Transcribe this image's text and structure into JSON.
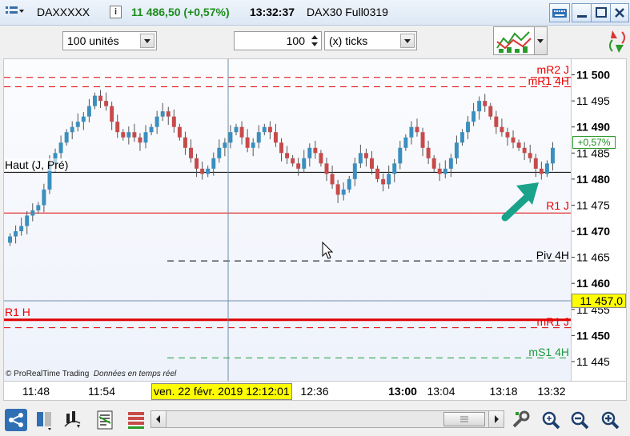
{
  "titlebar": {
    "symbol": "DAXXXXX",
    "info_icon": "info-icon",
    "price": "11 486,50",
    "change": "(+0,57%)",
    "time": "13:32:37",
    "instrument": "DAX30 Full0319"
  },
  "toolbar": {
    "quantity": "100 unités",
    "ticks_value": "100",
    "ticks_unit": "(x) ticks"
  },
  "chart": {
    "copyright": "© ProRealTime Trading",
    "realtime": "Données en temps réel",
    "crosshair_date": "ven. 22 févr. 2019 12:12:01",
    "current_price": "11 457,0",
    "change_badge": "+0,57%",
    "colors": {
      "up": "#3a8fbf",
      "down": "#c84a4a",
      "resistance": "#e00000",
      "support_green": "#1a9a3a",
      "arrow": "#1aa38a",
      "price_tag": "#ffff00"
    }
  },
  "levels": {
    "mR2_J": "mR2 J",
    "mR1_4H": "mR1 4H",
    "haut_j_pre": "Haut (J, Pré)",
    "R1_J": "R1 J",
    "Piv_4H": "Piv 4H",
    "R1_H": "R1 H",
    "mR1_J": "mR1 J",
    "mS1_4H": "mS1 4H"
  },
  "chart_data": {
    "type": "candlestick",
    "ylim": [
      11441,
      11503
    ],
    "y_ticks": [
      "11 500",
      "11 495",
      "11 490",
      "11 485",
      "11 480",
      "11 475",
      "11 470",
      "11 465",
      "11 460",
      "11 455",
      "11 450",
      "11 445"
    ],
    "x_ticks": [
      "11:48",
      "11:54",
      "12:36",
      "13:00",
      "13:04",
      "13:18",
      "13:32"
    ],
    "series_close": [
      11469,
      11470,
      11471,
      11473,
      11474,
      11475,
      11478,
      11483,
      11485,
      11487,
      11489,
      11490,
      11491,
      11492,
      11494,
      11496,
      11495,
      11494,
      11491,
      11489,
      11488,
      11489,
      11488,
      11487,
      11489,
      11490,
      11492,
      11493,
      11492,
      11490,
      11488,
      11486,
      11484,
      11482,
      11481,
      11482,
      11484,
      11486,
      11487,
      11489,
      11490,
      11488,
      11486,
      11487,
      11489,
      11490,
      11489,
      11487,
      11485,
      11484,
      11483,
      11482,
      11484,
      11486,
      11485,
      11483,
      11481,
      11479,
      11477,
      11478,
      11480,
      11483,
      11485,
      11484,
      11482,
      11480,
      11479,
      11481,
      11483,
      11486,
      11488,
      11490,
      11489,
      11486,
      11484,
      11482,
      11481,
      11482,
      11484,
      11487,
      11489,
      11491,
      11493,
      11495,
      11494,
      11492,
      11490,
      11489,
      11488,
      11487,
      11486,
      11485,
      11484,
      11482,
      11481,
      11483,
      11486
    ]
  },
  "bottombar": {
    "icons": [
      "share-icon",
      "layout-icon",
      "indicator-icon",
      "list-icon",
      "table-icon",
      "zoom-fit-icon",
      "zoom-out-icon",
      "zoom-in-icon",
      "zoom-plus-icon"
    ]
  }
}
